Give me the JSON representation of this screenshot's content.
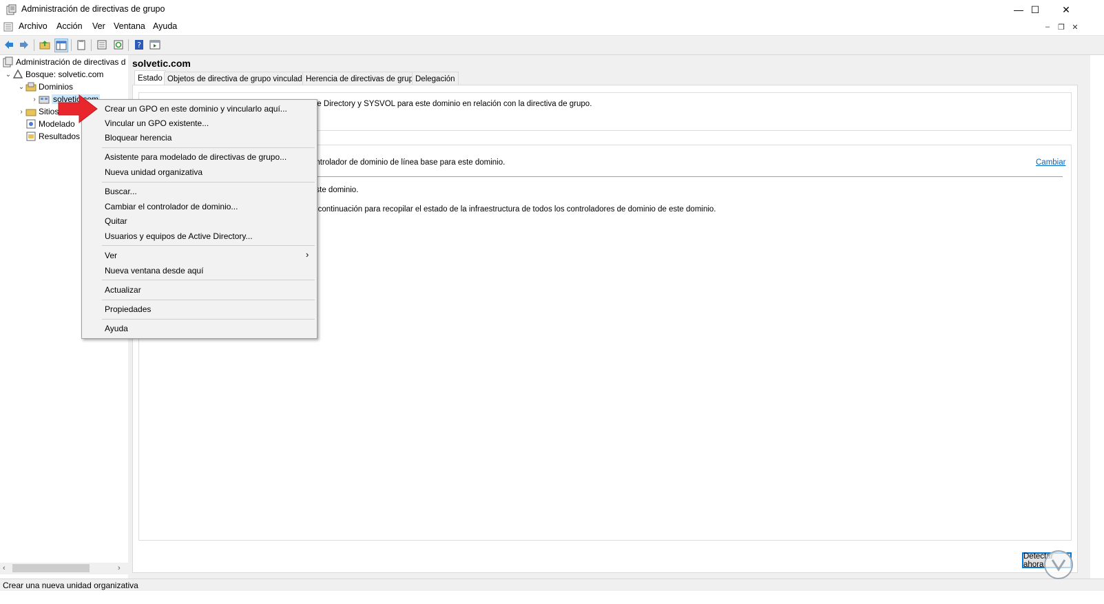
{
  "window": {
    "title": "Administración de directivas de grupo",
    "controls": {
      "minimize": "—",
      "maximize": "☐",
      "close": "✕"
    }
  },
  "menubar": {
    "items": [
      "Archivo",
      "Acción",
      "Ver",
      "Ventana",
      "Ayuda"
    ],
    "mdi": {
      "minimize": "–",
      "restore": "❐",
      "close": "✕"
    }
  },
  "toolbar": {
    "icons": [
      "back-arrow-icon",
      "forward-arrow-icon",
      "up-folder-icon",
      "show-hide-tree-icon",
      "clipboard-icon",
      "properties-icon",
      "refresh-icon",
      "help-icon",
      "console-icon"
    ]
  },
  "tree": {
    "root": "Administración de directivas d",
    "forest": "Bosque: solvetic.com",
    "domains": "Dominios",
    "domain": "solvetic.com",
    "sites": "Sitios",
    "modeling": "Modelado",
    "results": "Resultados"
  },
  "content": {
    "title": "solvetic.com",
    "tabs": [
      "Estado",
      "Objetos de directiva de grupo vinculados",
      "Herencia de directivas de grupo",
      "Delegación"
    ],
    "line1": "ive Directory y SYSVOL para este dominio en relación con la directiva de grupo.",
    "line2": "ontrolador de dominio de línea base para este dominio.",
    "change_link": "Cambiar",
    "line3": "este dominio.",
    "line4": "a continuación para recopilar el estado de la infraestructura de todos los controladores de dominio de este dominio.",
    "detect_button": "Detectar ahora"
  },
  "context_menu": {
    "items": [
      "Crear un GPO en este dominio y vincularlo aquí...",
      "Vincular un GPO existente...",
      "Bloquear herencia",
      "Asistente para modelado de directivas de grupo...",
      "Nueva unidad organizativa",
      "Buscar...",
      "Cambiar el controlador de dominio...",
      "Quitar",
      "Usuarios y equipos de Active Directory...",
      "Ver",
      "Nueva ventana desde aquí",
      "Actualizar",
      "Propiedades",
      "Ayuda"
    ],
    "submenu_indicator": "›"
  },
  "statusbar": {
    "text": "Crear una nueva unidad organizativa"
  },
  "colors": {
    "accent": "#0078d7",
    "link": "#0066cc",
    "arrow": "#e8262b",
    "chrome": "#f0f0f0"
  }
}
